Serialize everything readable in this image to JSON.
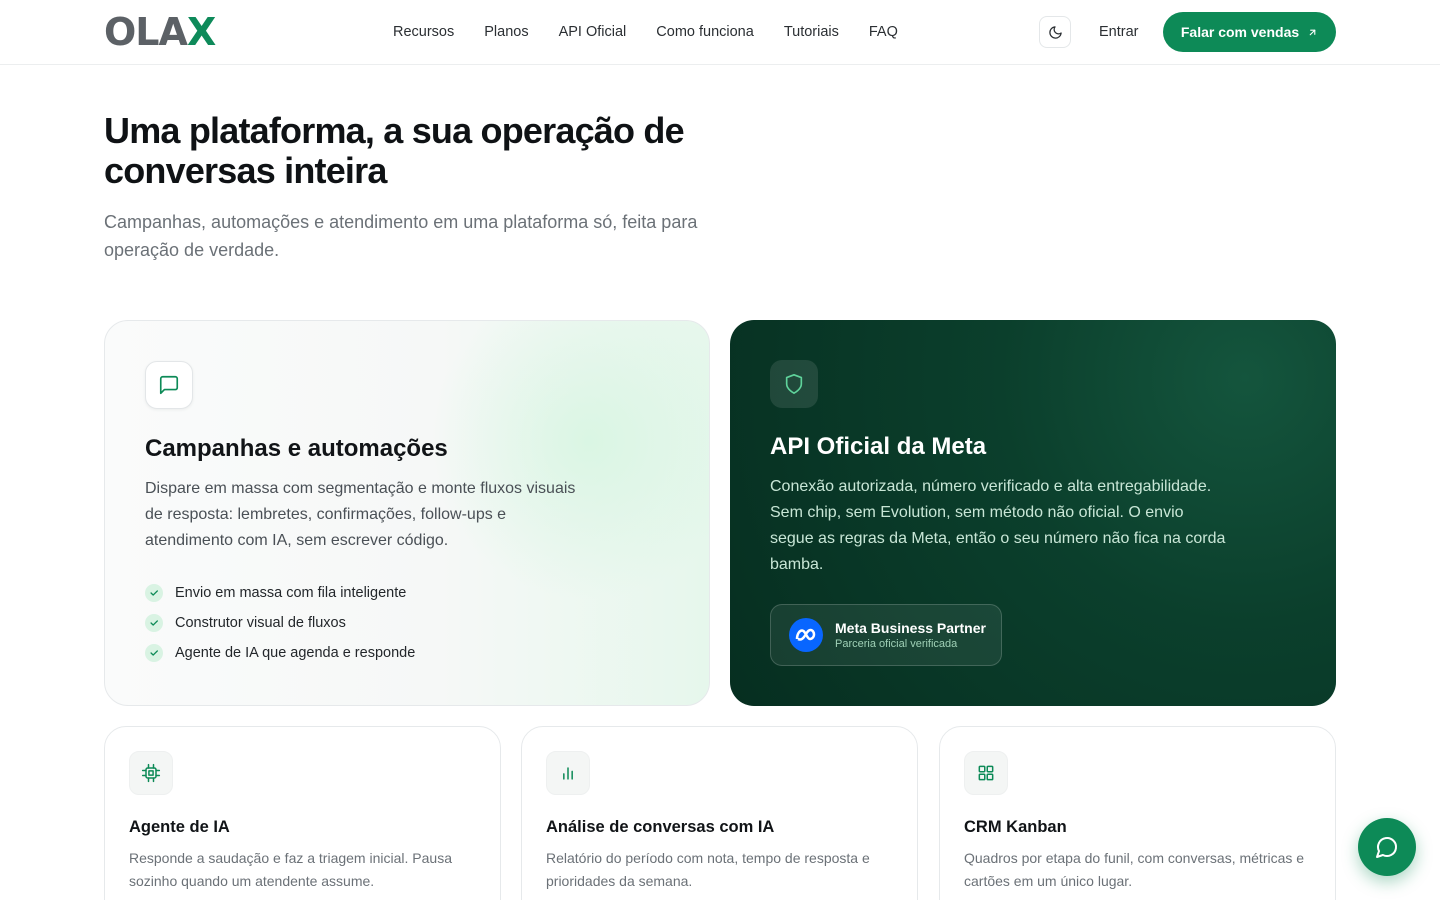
{
  "brand": {
    "logo_main": "OLA",
    "logo_accent": "X"
  },
  "nav": {
    "items": [
      "Recursos",
      "Planos",
      "API Oficial",
      "Como funciona",
      "Tutoriais",
      "FAQ"
    ],
    "login": "Entrar",
    "cta": "Falar com vendas"
  },
  "hero": {
    "title": "Uma plataforma, a sua operação de conversas inteira",
    "subtitle": "Campanhas, automações e atendimento em uma plataforma só, feita para operação de verdade."
  },
  "card_campaigns": {
    "title": "Campanhas e automações",
    "description": "Dispare em massa com segmentação e monte fluxos visuais de resposta: lembretes, confirmações, follow-ups e atendimento com IA, sem escrever código.",
    "features": [
      "Envio em massa com fila inteligente",
      "Construtor visual de fluxos",
      "Agente de IA que agenda e responde"
    ]
  },
  "card_api": {
    "title": "API Oficial da Meta",
    "description": "Conexão autorizada, número verificado e alta entregabilidade. Sem chip, sem Evolution, sem método não oficial. O envio segue as regras da Meta, então o seu número não fica na corda bamba.",
    "badge_title": "Meta Business Partner",
    "badge_subtitle": "Parceria oficial verificada"
  },
  "small_cards": [
    {
      "title": "Agente de IA",
      "description": "Responde a saudação e faz a triagem inicial. Pausa sozinho quando um atendente assume.",
      "icon": "chip-icon"
    },
    {
      "title": "Análise de conversas com IA",
      "description": "Relatório do período com nota, tempo de resposta e prioridades da semana.",
      "icon": "bar-chart-icon"
    },
    {
      "title": "CRM Kanban",
      "description": "Quadros por etapa do funil, com conversas, métricas e cartões em um único lugar.",
      "icon": "grid-icon"
    }
  ],
  "colors": {
    "accent": "#0d8a57",
    "dark_card": "#0b3f2c",
    "meta_blue": "#0866ff"
  }
}
